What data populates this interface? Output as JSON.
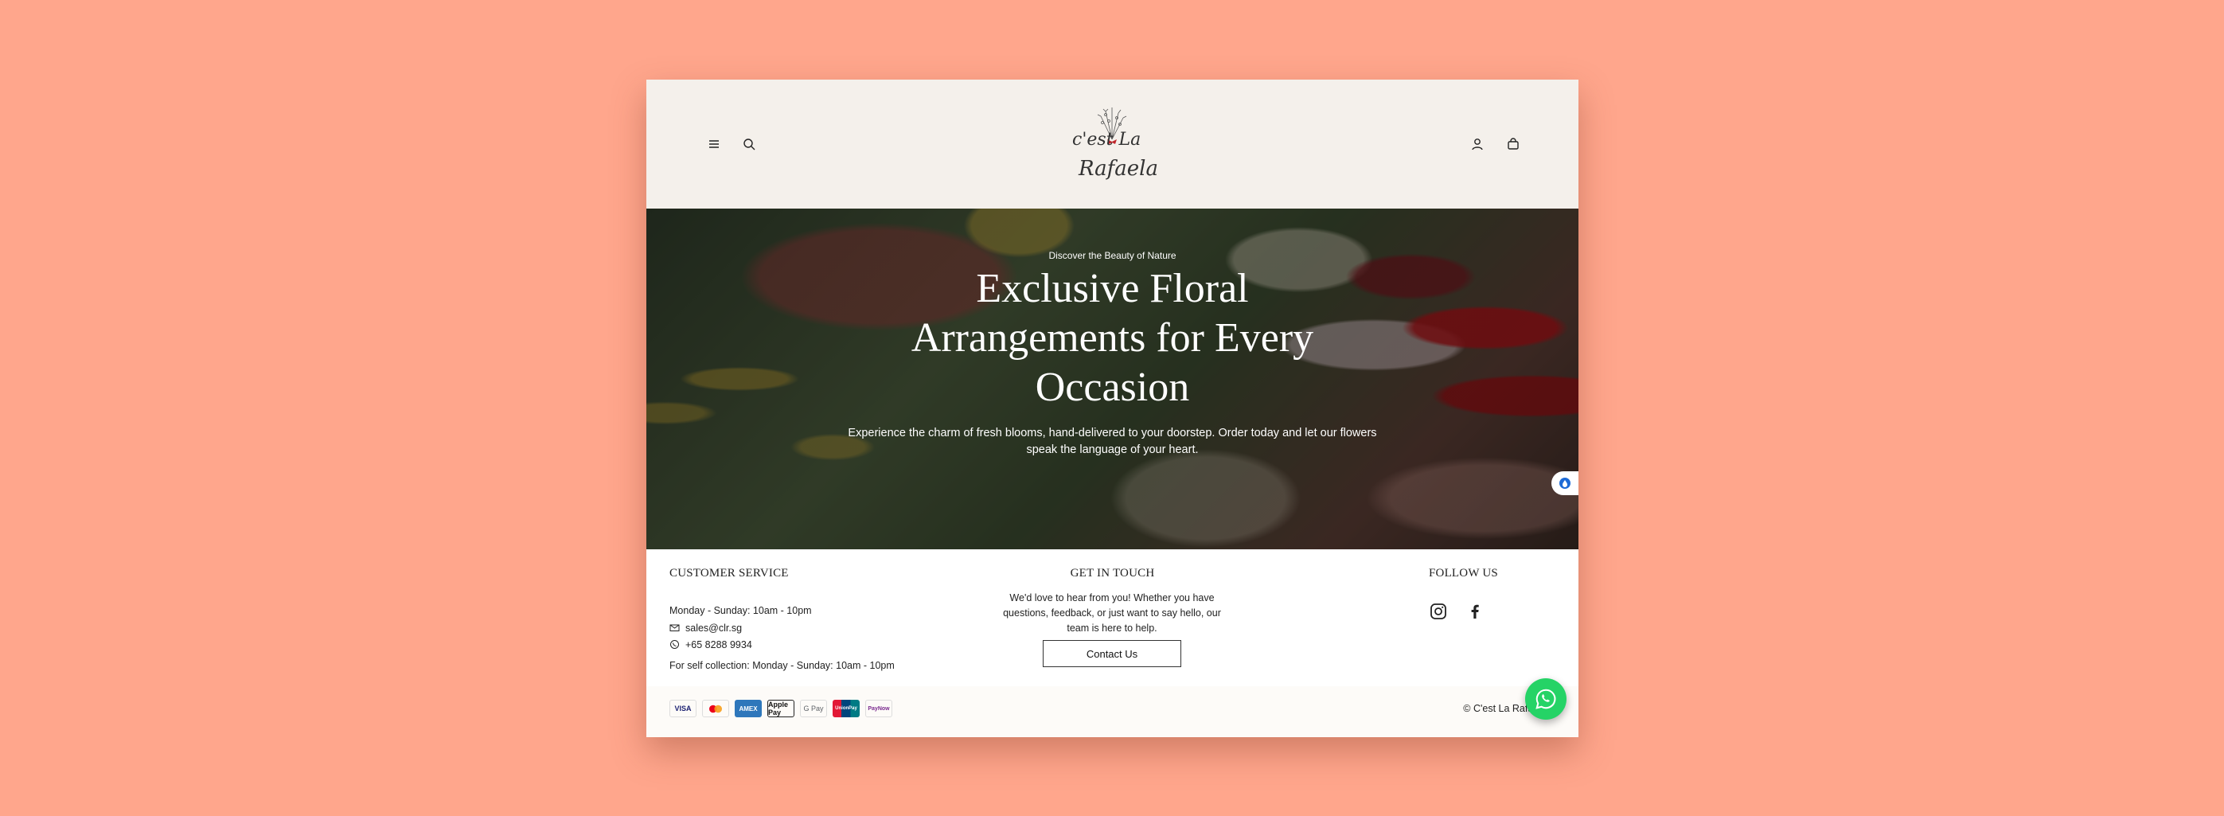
{
  "header": {
    "menu_icon": "menu-icon",
    "search_icon": "search-icon",
    "logo_text_line1": "c'est La",
    "logo_text_line2": "Rafaela",
    "account_icon": "user-icon",
    "cart_icon": "shopping-bag-icon"
  },
  "hero": {
    "eyebrow": "Discover the Beauty of Nature",
    "title": "Exclusive Floral Arrangements for Every Occasion",
    "text": "Experience the charm of fresh blooms, hand-delivered to your doorstep. Order today and let our flowers speak the language of your heart."
  },
  "footer": {
    "customer_service": {
      "title": "CUSTOMER SERVICE",
      "hours": "Monday - Sunday: 10am - 10pm",
      "email": "sales@clr.sg",
      "phone": "+65 8288 9934",
      "collection": "For self collection: Monday - Sunday: 10am - 10pm"
    },
    "get_in_touch": {
      "title": "GET IN TOUCH",
      "text": "We'd love to hear from you! Whether you have questions, feedback, or just want to say hello, our team is here to help.",
      "button": "Contact Us"
    },
    "follow_us": {
      "title": "FOLLOW US",
      "icons": [
        "instagram-icon",
        "facebook-icon"
      ]
    },
    "payments": [
      "VISA",
      "Mastercard",
      "AMEX",
      "Apple Pay",
      "G Pay",
      "UnionPay",
      "PayNow"
    ],
    "copyright": "© C'est La Rafaela"
  },
  "colors": {
    "page_bg": "#ffa68c",
    "header_bg": "#f4f0eb",
    "whatsapp": "#25d366"
  }
}
